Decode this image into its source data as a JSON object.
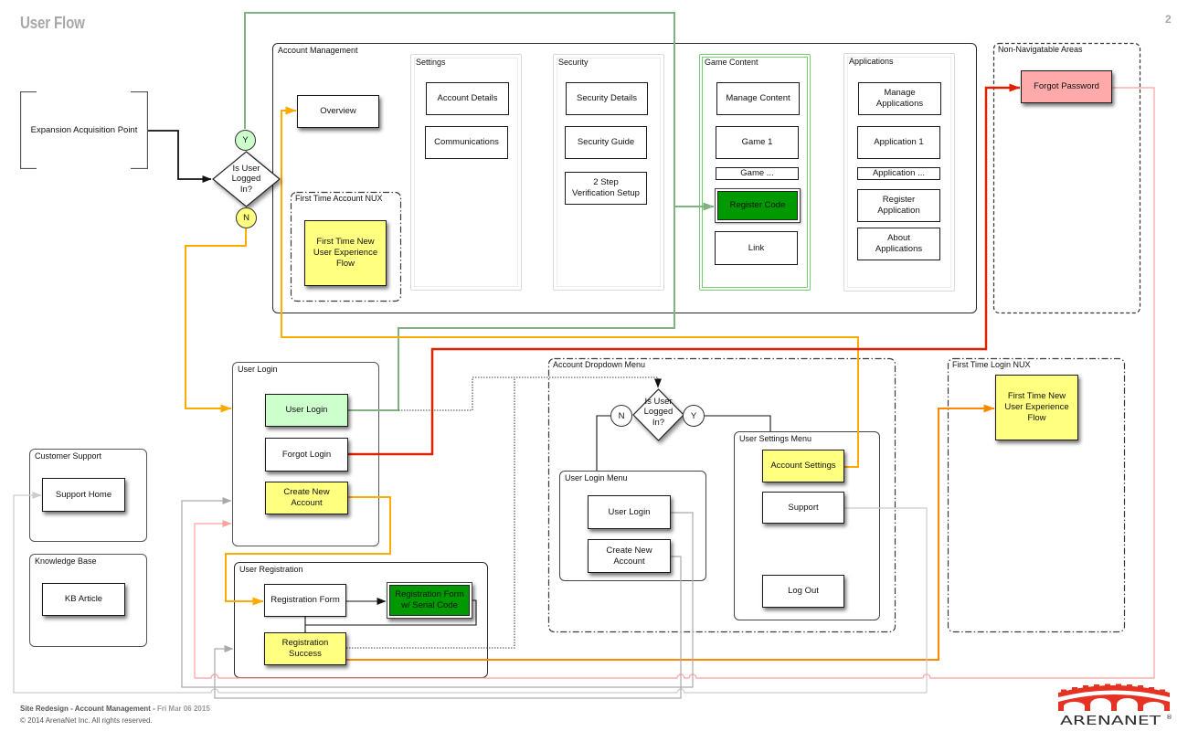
{
  "page": {
    "title": "User Flow",
    "page_number": "2"
  },
  "entry_point": {
    "label": "Expansion Acquisition Point"
  },
  "main_decision": {
    "question": "Is User\nLogged\nIn?",
    "yes": "Y",
    "no": "N"
  },
  "account_management": {
    "title": "Account Management",
    "overview": "Overview",
    "first_time_account_nux": {
      "title": "First Time Account NUX",
      "flow": "First Time New\nUser Experience\nFlow"
    },
    "settings": {
      "title": "Settings",
      "items": [
        "Account Details",
        "Communications"
      ]
    },
    "security": {
      "title": "Security",
      "items": [
        "Security Details",
        "Security Guide",
        "2 Step\nVerification Setup"
      ]
    },
    "game_content": {
      "title": "Game Content",
      "items": [
        "Manage Content",
        "Game 1",
        "Game ...",
        "Register Code",
        "Link"
      ]
    },
    "applications": {
      "title": "Applications",
      "items": [
        "Manage\nApplications",
        "Application 1",
        "Application ...",
        "Register\nApplication",
        "About\nApplications"
      ]
    }
  },
  "non_navigable_areas": {
    "title": "Non-Navigatable Areas",
    "items": [
      "Forgot Password"
    ]
  },
  "user_login": {
    "title": "User Login",
    "items": [
      "User Login",
      "Forgot Login",
      "Create New\nAccount"
    ]
  },
  "customer_support": {
    "title": "Customer Support",
    "items": [
      "Support Home"
    ]
  },
  "knowledge_base": {
    "title": "Knowledge Base",
    "items": [
      "KB Article"
    ]
  },
  "user_registration": {
    "title": "User Registration",
    "items": [
      "Registration Form",
      "Registration Form\nw/ Serial Code",
      "Registration\nSuccess"
    ]
  },
  "account_dropdown_menu": {
    "title": "Account Dropdown Menu",
    "decision": {
      "question": "Is User\nLogged\nIn?",
      "yes": "Y",
      "no": "N"
    },
    "user_login_menu": {
      "title": "User Login Menu",
      "items": [
        "User Login",
        "Create New\nAccount"
      ]
    },
    "user_settings_menu": {
      "title": "User Settings Menu",
      "items": [
        "Account Settings",
        "Support",
        "Log Out"
      ]
    }
  },
  "first_time_login_nux": {
    "title": "First Time Login NUX",
    "flow": "First Time New\nUser Experience\nFlow"
  },
  "footer": {
    "project": "Site Redesign - Account Management",
    "separator": " - ",
    "date": "Fri Mar 06 2015",
    "copyright": "© 2014 ArenaNet Inc. All rights reserved."
  },
  "logo": {
    "wordmark": "ARENANET",
    "registered": "®"
  },
  "colors": {
    "title_gray": "#a8a8a8",
    "line_black": "#111111",
    "yes_fill": "#ccffcc",
    "no_fill": "#ffff80",
    "highlight_yellow": "#ffff80",
    "login_green": "#ccffcc",
    "register_green": "#009900",
    "forgot_password_pink": "#ffaaaa",
    "game_content_border": "#77cc77",
    "connector_green": "#80b380",
    "connector_orange": "#ffaa00",
    "connector_dark_orange": "#ff8800",
    "connector_red": "#dd2200",
    "connector_pink": "#ff9f9f",
    "connector_gray": "#aaaaaa",
    "connector_light_gray": "#cccccc",
    "logo_red": "#e53222",
    "logo_text": "#2d2d2d"
  }
}
